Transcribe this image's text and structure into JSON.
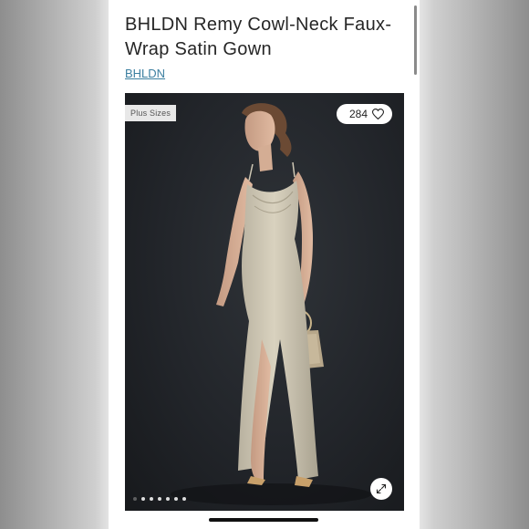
{
  "listing": {
    "title": "BHLDN Remy Cowl-Neck Faux-Wrap Satin Gown",
    "brand": "BHLDN"
  },
  "gallery": {
    "tag": "Plus Sizes",
    "like_count": "284",
    "image_count": 7,
    "active_index": 1
  },
  "icons": {
    "like": "heart-icon",
    "expand": "expand-arrows-icon"
  },
  "colors": {
    "brand_link": "#3c7fa0",
    "gallery_bg": "#22252a",
    "gown": "#cfc8b5"
  }
}
